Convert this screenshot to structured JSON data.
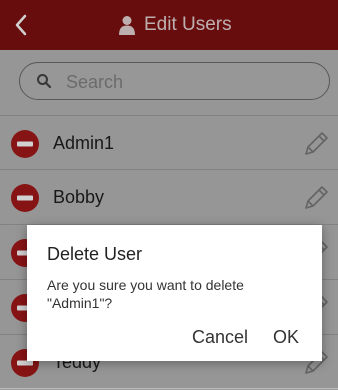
{
  "header": {
    "title": "Edit Users",
    "back_icon": "chevron-left-icon",
    "title_icon": "user-icon"
  },
  "search": {
    "placeholder": "Search",
    "value": ""
  },
  "users": [
    {
      "name": "Admin1"
    },
    {
      "name": "Bobby"
    },
    {
      "name": ""
    },
    {
      "name": ""
    },
    {
      "name": "Teddy"
    }
  ],
  "dialog": {
    "title": "Delete User",
    "message": "Are you sure you want to delete \"Admin1\"?",
    "cancel_label": "Cancel",
    "ok_label": "OK"
  },
  "colors": {
    "header_bg": "#7e1111",
    "delete_red": "#a5191a",
    "list_bg": "#b8b8b8"
  }
}
